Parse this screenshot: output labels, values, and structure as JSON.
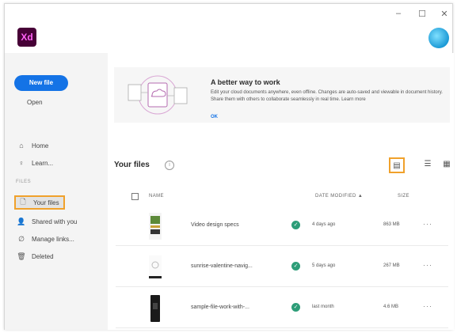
{
  "app": {
    "logo": "Xd"
  },
  "window_controls": [
    "–",
    "☐",
    "✕"
  ],
  "sidebar": {
    "new_file": "New file",
    "open": "Open",
    "nav": [
      {
        "label": "Home",
        "icon": "home-icon"
      },
      {
        "label": "Learn...",
        "icon": "lightbulb-icon"
      }
    ],
    "section_label": "FILES",
    "files_nav": [
      {
        "label": "Your files",
        "icon": "file-icon",
        "active": true
      },
      {
        "label": "Shared with you",
        "icon": "people-icon"
      },
      {
        "label": "Manage links...",
        "icon": "link-icon"
      },
      {
        "label": "Deleted",
        "icon": "trash-icon"
      }
    ]
  },
  "banner": {
    "title": "A better way to work",
    "body": "Edit your cloud documents anywhere, even offline. Changes are auto-saved and viewable in document history. Share them with others to collaborate seamlessly in real time. Learn more",
    "ok": "OK"
  },
  "main": {
    "title": "Your files",
    "columns": {
      "name": "NAME",
      "date": "DATE MODIFIED ▲",
      "size": "SIZE"
    }
  },
  "files": [
    {
      "name": "Video design specs",
      "date": "4 days ago",
      "size": "863 MB",
      "status": "synced"
    },
    {
      "name": "sunrise-valentine-navig...",
      "date": "5 days ago",
      "size": "267 MB",
      "status": "synced"
    },
    {
      "name": "sample-file-work-with-...",
      "date": "last month",
      "size": "4.6 MB",
      "status": "synced"
    }
  ],
  "colors": {
    "accent": "#1473e6",
    "highlight": "#f0a12b",
    "synced": "#2d9d78",
    "brand": "#470137"
  }
}
